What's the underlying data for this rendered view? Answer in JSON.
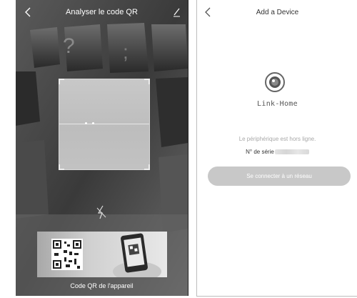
{
  "left_screen": {
    "title": "Analyser le code QR",
    "icons": {
      "back": "chevron-left-icon",
      "edit": "pencil-icon",
      "flash": "flash-off-icon"
    },
    "hint_caption": "Code QR de l'appareil"
  },
  "right_screen": {
    "title": "Add a Device",
    "icons": {
      "back": "chevron-left-icon",
      "logo": "link-home-camera-logo-icon"
    },
    "brand": "Link-Home",
    "offline_text": "Le périphérique est hors ligne.",
    "serial_label": "N° de série",
    "connect_button": "Se connecter à un réseau"
  },
  "colors": {
    "scan_background": "#3c3c3c",
    "button_gray": "#c8c8c8",
    "muted_text": "#a8a8a8"
  }
}
